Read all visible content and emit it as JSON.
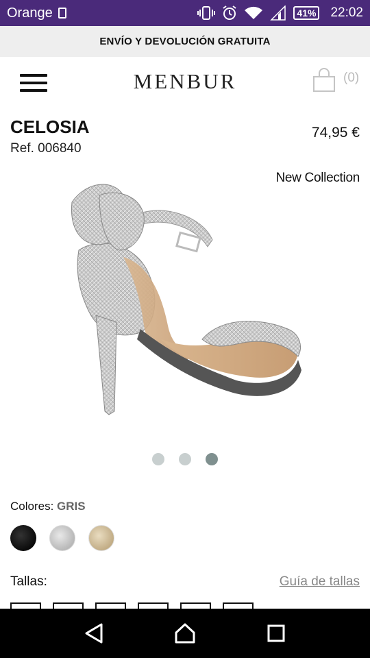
{
  "status_bar": {
    "carrier": "Orange",
    "battery": "41%",
    "time": "22:02",
    "icons": [
      "sim-card-icon",
      "vibrate-icon",
      "alarm-icon",
      "wifi-icon",
      "signal-icon",
      "battery-icon"
    ]
  },
  "promo": {
    "text": "ENVÍO Y DEVOLUCIÓN GRATUITA"
  },
  "header": {
    "logo": "MENBUR",
    "cart_count": "(0)",
    "icons": [
      "menu-icon",
      "shopping-bag-icon"
    ]
  },
  "product": {
    "name": "CELOSIA",
    "ref": "Ref. 006840",
    "price": "74,95 €",
    "badge": "New Collection"
  },
  "carousel": {
    "dots": 3,
    "active_index": 2
  },
  "colors": {
    "label": "Colores:",
    "selected": "GRIS",
    "swatches": [
      "black",
      "silver",
      "gold"
    ]
  },
  "sizes": {
    "label": "Tallas:",
    "guide_link": "Guía de tallas"
  },
  "nav_bar": {
    "icons": [
      "back-icon",
      "home-icon",
      "recents-icon"
    ]
  }
}
